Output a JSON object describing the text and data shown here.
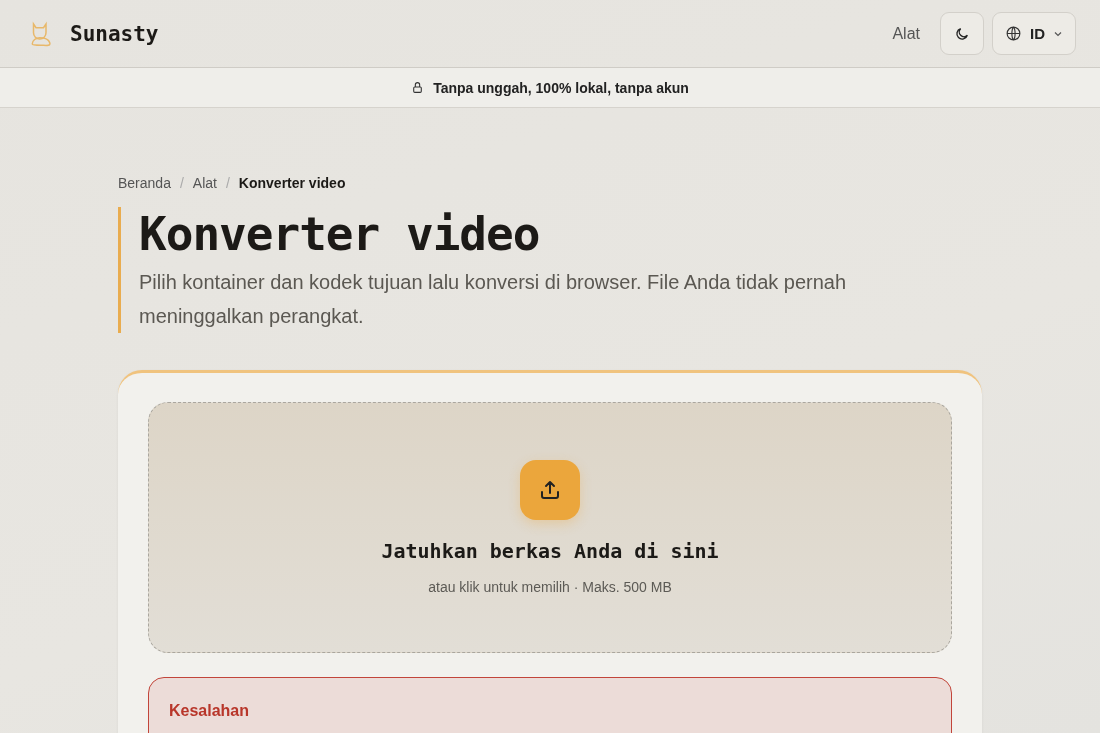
{
  "header": {
    "brand": "Sunasty",
    "nav_link": "Alat",
    "language": "ID"
  },
  "banner": {
    "text": "Tanpa unggah, 100% lokal, tanpa akun"
  },
  "breadcrumb": [
    {
      "label": "Beranda",
      "current": false
    },
    {
      "label": "Alat",
      "current": false
    },
    {
      "label": "Konverter video",
      "current": true
    }
  ],
  "separator": "/",
  "title": "Konverter video",
  "description": "Pilih kontainer dan kodek tujuan lalu konversi di browser. File Anda tidak pernah meninggalkan perangkat.",
  "dropzone": {
    "title": "Jatuhkan berkas Anda di sini",
    "hint": "atau klik untuk memilih · Maks. 500 MB"
  },
  "error": {
    "title": "Kesalahan"
  }
}
